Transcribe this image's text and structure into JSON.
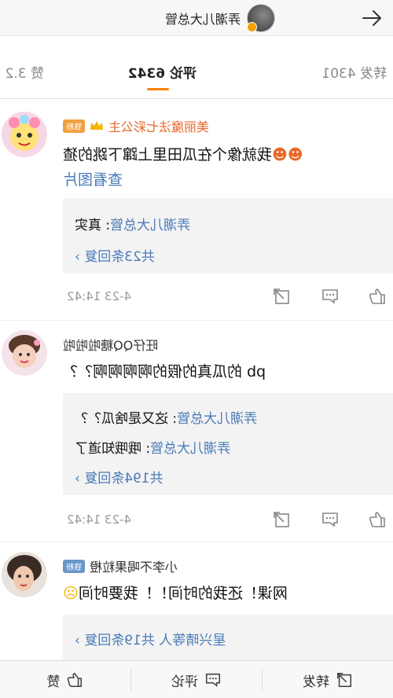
{
  "header": {
    "title": "弄潮儿大总管"
  },
  "tabs": [
    {
      "label": "转发 4301"
    },
    {
      "label": "评论 6342"
    },
    {
      "label": "赞 3.2"
    }
  ],
  "comments": [
    {
      "name": "美丽魔法七彩公主",
      "badge": "铁粉",
      "text": "我就像个在瓜田里上蹿下跳的猹",
      "link": "查看图片",
      "replies": [
        {
          "name": "弄潮儿大总管",
          "text": ": 真实"
        }
      ],
      "more": "共23条回复",
      "time": "4-23 14:42"
    },
    {
      "name": "旺仔QQ糖啦啦啦",
      "text": "pb 的瓜真的假的啊啊啊啊？？",
      "replies": [
        {
          "name": "弄潮儿大总管",
          "text": ": 这又是啥瓜？？"
        },
        {
          "name": "弄潮儿大总管",
          "text": ": 哦哦知道了"
        }
      ],
      "more": "共194条回复",
      "time": "4-23 14:42"
    },
    {
      "name": "小李不喝果粒橙",
      "badge": "铁粉",
      "text": "网课！还我的时间！！我要时间",
      "replies": [],
      "more_name": "星兴晴等人",
      "more": "共19条回复"
    }
  ],
  "bottombar": {
    "repost_label": "转发",
    "comment_label": "评论",
    "like_label": "赞"
  }
}
